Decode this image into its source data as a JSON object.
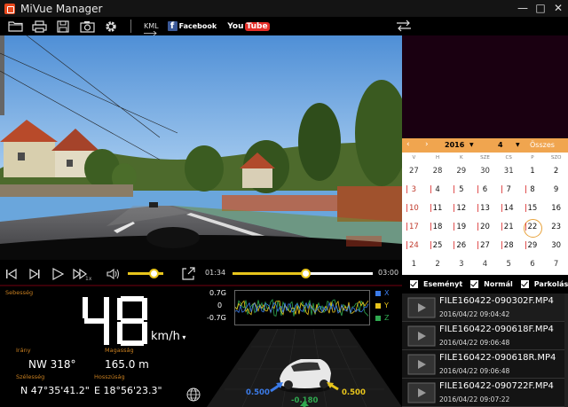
{
  "window": {
    "title": "MiVue Manager",
    "min": "—",
    "max": "□",
    "close": "✕"
  },
  "toolbar": {
    "icons": [
      "folder-icon",
      "print-icon",
      "save-icon",
      "camera-icon",
      "gear-icon"
    ],
    "kml": "KML",
    "facebook": "Facebook",
    "youtube_you": "You",
    "youtube_tube": "Tube"
  },
  "playback": {
    "rate_label": "1x",
    "current_time": "01:34",
    "total_time": "03:00",
    "volume_level": 0.72,
    "progress": 0.52
  },
  "speed": {
    "label": "Sebesség",
    "value": "48",
    "unit": "km/h",
    "direction_label": "Irány",
    "direction_value": "NW 318°",
    "altitude_label": "Magasság",
    "altitude_value": "165.0  m",
    "lat_label": "Szélesség",
    "lat_value": "N 47°35'41.2\"",
    "lon_label": "Hosszúság",
    "lon_value": "E 18°56'23.3\""
  },
  "gsensor": {
    "top": "0.7G",
    "mid": "0",
    "bottom": "-0.7G",
    "legend": [
      {
        "name": "X",
        "color": "#3b7be8"
      },
      {
        "name": "Y",
        "color": "#e8c51c"
      },
      {
        "name": "Z",
        "color": "#2fa84f"
      }
    ],
    "x_value": "0.500",
    "y_value": "0.500",
    "z_value": "-0.180"
  },
  "calendar": {
    "year": "2016",
    "month": "4",
    "all": "Összes",
    "dow": [
      "V",
      "H",
      "K",
      "SZE",
      "CS",
      "P",
      "SZO"
    ],
    "days": [
      {
        "d": "27",
        "c": "dim"
      },
      {
        "d": "28",
        "c": "dim"
      },
      {
        "d": "29",
        "c": "dim"
      },
      {
        "d": "30",
        "c": "dim"
      },
      {
        "d": "31",
        "c": "dim"
      },
      {
        "d": "1",
        "c": ""
      },
      {
        "d": "2",
        "c": ""
      },
      {
        "d": "3",
        "c": "sun"
      },
      {
        "d": "4",
        "c": ""
      },
      {
        "d": "5",
        "c": ""
      },
      {
        "d": "6",
        "c": ""
      },
      {
        "d": "7",
        "c": ""
      },
      {
        "d": "8",
        "c": ""
      },
      {
        "d": "9",
        "c": ""
      },
      {
        "d": "10",
        "c": "sun"
      },
      {
        "d": "11",
        "c": ""
      },
      {
        "d": "12",
        "c": ""
      },
      {
        "d": "13",
        "c": ""
      },
      {
        "d": "14",
        "c": ""
      },
      {
        "d": "15",
        "c": ""
      },
      {
        "d": "16",
        "c": ""
      },
      {
        "d": "17",
        "c": "sun"
      },
      {
        "d": "18",
        "c": ""
      },
      {
        "d": "19",
        "c": ""
      },
      {
        "d": "20",
        "c": ""
      },
      {
        "d": "21",
        "c": ""
      },
      {
        "d": "22",
        "c": "sel"
      },
      {
        "d": "23",
        "c": ""
      },
      {
        "d": "24",
        "c": "sun"
      },
      {
        "d": "25",
        "c": ""
      },
      {
        "d": "26",
        "c": ""
      },
      {
        "d": "27",
        "c": ""
      },
      {
        "d": "28",
        "c": ""
      },
      {
        "d": "29",
        "c": ""
      },
      {
        "d": "30",
        "c": ""
      },
      {
        "d": "1",
        "c": "dim"
      },
      {
        "d": "2",
        "c": "dim"
      },
      {
        "d": "3",
        "c": "dim"
      },
      {
        "d": "4",
        "c": "dim"
      },
      {
        "d": "5",
        "c": "dim"
      },
      {
        "d": "6",
        "c": "dim"
      },
      {
        "d": "7",
        "c": "dim"
      }
    ]
  },
  "filters": [
    "Eseményt",
    "Normál",
    "Parkolás"
  ],
  "files": [
    {
      "name": "FILE160422-090302F.MP4",
      "date": "2016/04/22   09:04:42"
    },
    {
      "name": "FILE160422-090618F.MP4",
      "date": "2016/04/22   09:06:48"
    },
    {
      "name": "FILE160422-090618R.MP4",
      "date": "2016/04/22   09:06:48"
    },
    {
      "name": "FILE160422-090722F.MP4",
      "date": "2016/04/22   09:07:22"
    }
  ]
}
